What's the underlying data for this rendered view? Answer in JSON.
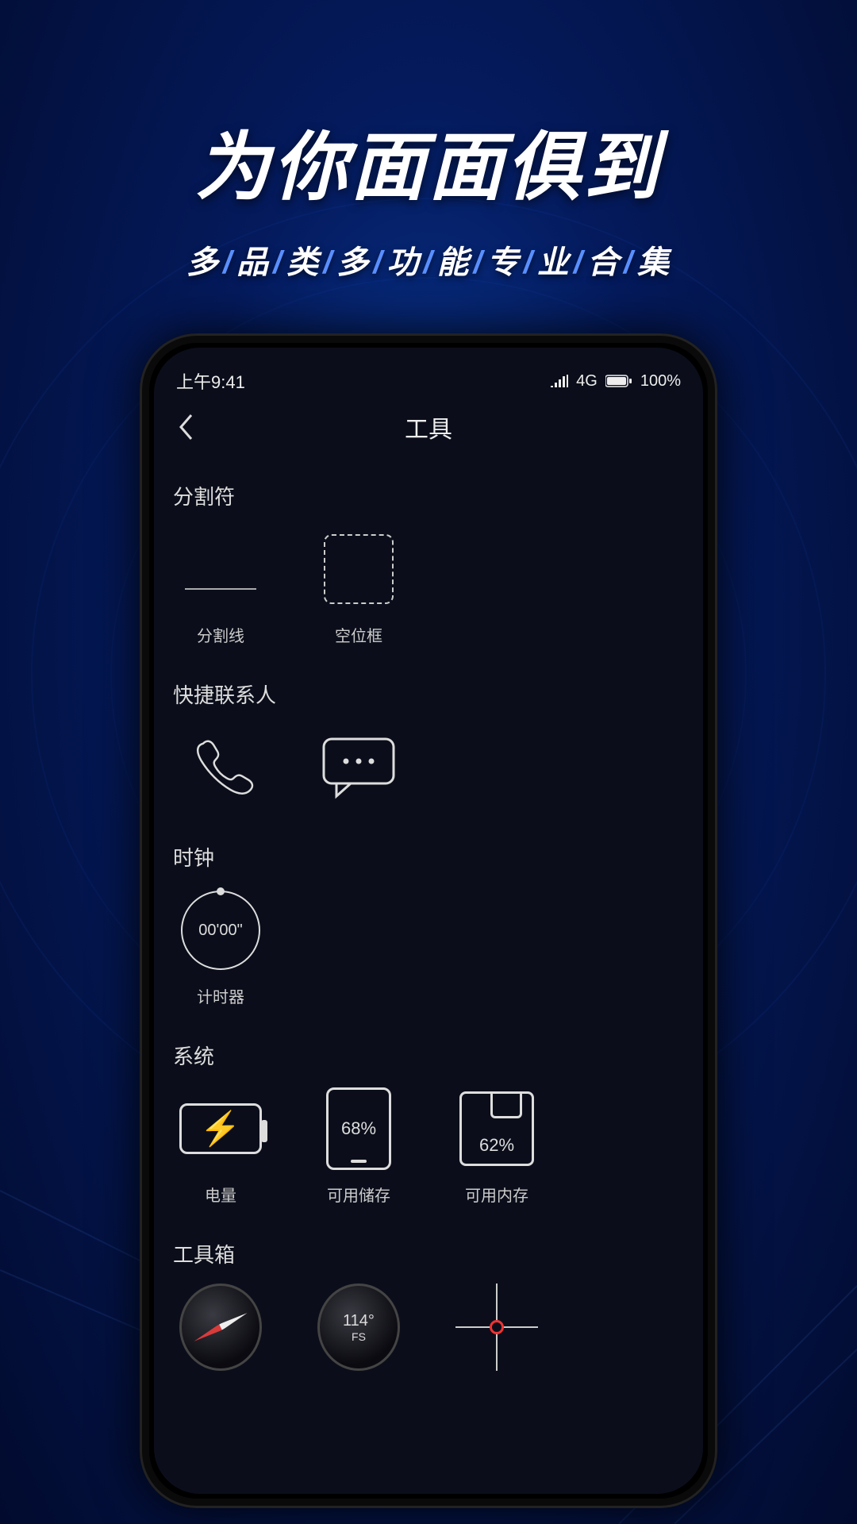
{
  "hero": {
    "title": "为你面面俱到",
    "subtitle_chars": [
      "多",
      "品",
      "类",
      "多",
      "功",
      "能",
      "专",
      "业",
      "合",
      "集"
    ]
  },
  "status": {
    "time": "上午9:41",
    "network": "4G",
    "battery": "100%"
  },
  "header": {
    "title": "工具"
  },
  "sections": {
    "separator": {
      "label": "分割符",
      "items": [
        {
          "caption": "分割线"
        },
        {
          "caption": "空位框"
        }
      ]
    },
    "contacts": {
      "label": "快捷联系人"
    },
    "clock": {
      "label": "时钟",
      "timer_value": "00'00\"",
      "timer_caption": "计时器"
    },
    "system": {
      "label": "系统",
      "battery_caption": "电量",
      "storage_value": "68%",
      "storage_caption": "可用储存",
      "memory_value": "62%",
      "memory_caption": "可用内存"
    },
    "toolbox": {
      "label": "工具箱",
      "heading_value": "114°",
      "heading_sub": "FS"
    }
  }
}
